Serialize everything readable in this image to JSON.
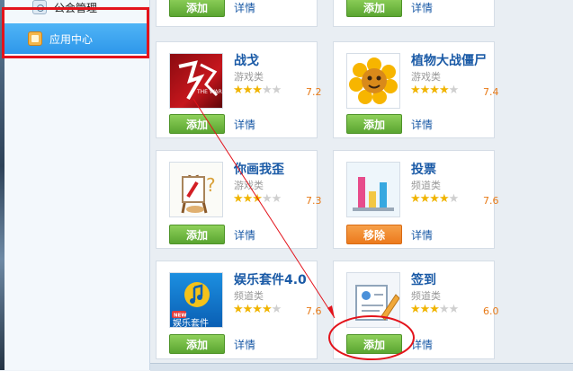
{
  "sidebar": {
    "items": [
      {
        "label": "公会管理",
        "icon": "guild-icon"
      },
      {
        "label": "应用中心",
        "icon": "app-center-icon",
        "selected": true
      }
    ]
  },
  "top_row": {
    "left": {
      "button": "添加",
      "detail": "详情"
    },
    "right": {
      "button": "添加",
      "detail": "详情"
    }
  },
  "apps": [
    {
      "title": "战戈",
      "category": "游戏类",
      "rating": 3.5,
      "score": "7.2",
      "button": "添加",
      "detail": "详情",
      "icon": "zhange-game-icon",
      "icon_text": "THE WAR"
    },
    {
      "title": "植物大战僵尸",
      "category": "游戏类",
      "rating": 3.5,
      "score": "7.4",
      "button": "添加",
      "detail": "详情",
      "icon": "sunflower-icon"
    },
    {
      "title": "你画我歪",
      "category": "游戏类",
      "rating": 3.5,
      "score": "7.3",
      "button": "添加",
      "detail": "详情",
      "icon": "easel-icon"
    },
    {
      "title": "投票",
      "category": "频道类",
      "rating": 4,
      "score": "7.6",
      "button": "移除",
      "detail": "详情",
      "icon": "vote-chart-icon"
    },
    {
      "title": "娱乐套件4.0",
      "category": "频道类",
      "rating": 4,
      "score": "7.6",
      "button": "添加",
      "detail": "详情",
      "icon": "music-suite-icon",
      "icon_badge": "NEW",
      "icon_text": "娱乐套件"
    },
    {
      "title": "签到",
      "category": "频道类",
      "rating": 3,
      "score": "6.0",
      "button": "添加",
      "detail": "详情",
      "icon": "sign-in-icon"
    }
  ],
  "annotation_colors": {
    "highlight": "#e3131b"
  },
  "colors": {
    "title": "#1a5aa6",
    "add_button": "#6ab53b",
    "remove_button": "#f08a2a",
    "score": "#e87a17",
    "selected_nav": "#3aa3ee"
  }
}
